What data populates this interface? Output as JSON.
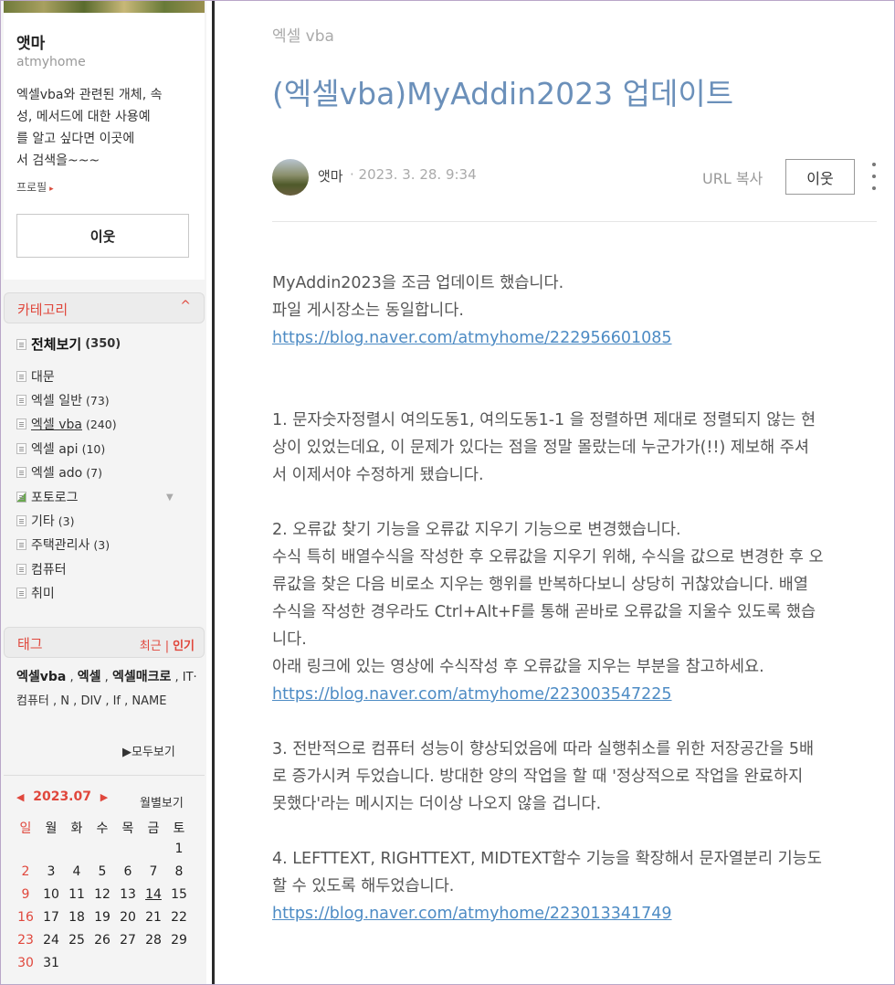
{
  "sidebar": {
    "profile": {
      "name": "앳마",
      "id": "atmyhome",
      "desc": "엑셀vba와 관련된 개체, 속\n성, 메서드에 대한 사용예\n를 알고 싶다면  이곳에\n서 검색을~~~",
      "profile_link": "프로필",
      "neighbor_button": "이웃"
    },
    "category": {
      "title": "카테고리",
      "collapse_glyph": "^",
      "all": {
        "label": "전체보기",
        "count": "(350)"
      },
      "items": [
        {
          "label": "대문",
          "count": ""
        },
        {
          "label": "엑셀 일반",
          "count": "(73)"
        },
        {
          "label": "엑셀 vba",
          "count": "(240)"
        },
        {
          "label": "엑셀 api",
          "count": "(10)"
        },
        {
          "label": "엑셀 ado",
          "count": "(7)"
        },
        {
          "label": "포토로그",
          "count": ""
        },
        {
          "label": "기타",
          "count": "(3)"
        },
        {
          "label": "주택관리사",
          "count": "(3)"
        },
        {
          "label": "컴퓨터",
          "count": ""
        },
        {
          "label": "취미",
          "count": ""
        }
      ]
    },
    "tags": {
      "title": "태그",
      "tab_recent": "최근",
      "tab_popular": "인기",
      "t1": "엑셀vba",
      "t2": "엑셀",
      "t3": "엑셀매크로",
      "t4": "IT·컴퓨터",
      "t5": "N",
      "t6": "DIV",
      "t7": "If",
      "t8": "NAME",
      "view_all": "▶모두보기"
    },
    "calendar": {
      "month": "2023.07",
      "prev": "◀",
      "next": "▶",
      "monthly_view": "월별보기",
      "weekdays": [
        "일",
        "월",
        "화",
        "수",
        "목",
        "금",
        "토"
      ],
      "weeks": [
        [
          "",
          "",
          "",
          "",
          "",
          "",
          "1"
        ],
        [
          "2",
          "3",
          "4",
          "5",
          "6",
          "7",
          "8"
        ],
        [
          "9",
          "10",
          "11",
          "12",
          "13",
          "14",
          "15"
        ],
        [
          "16",
          "17",
          "18",
          "19",
          "20",
          "21",
          "22"
        ],
        [
          "23",
          "24",
          "25",
          "26",
          "27",
          "28",
          "29"
        ],
        [
          "30",
          "31",
          "",
          "",
          "",
          "",
          ""
        ]
      ]
    }
  },
  "post": {
    "category": "엑셀 vba",
    "title": "(엑셀vba)MyAddin2023 업데이트",
    "author": "앳마",
    "date": "· 2023. 3. 28. 9:34",
    "url_copy": "URL 복사",
    "neighbor_button": "이웃",
    "body": {
      "intro1": "MyAddin2023을 조금 업데이트 했습니다.",
      "intro2": "파일 게시장소는 동일합니다.",
      "link1": "https://blog.naver.com/atmyhome/222956601085",
      "item1_l1": "1. 문자숫자정렬시 여의도동1, 여의도동1-1 을 정렬하면 제대로 정렬되지 않는 현",
      "item1_l2": "상이 있었는데요, 이 문제가 있다는 점을 정말 몰랐는데 누군가가(!!) 제보해 주셔",
      "item1_l3": "서 이제서야 수정하게 됐습니다.",
      "item2_l1": "2. 오류값 찾기 기능을 오류값 지우기 기능으로 변경했습니다.",
      "item2_l2": "수식 특히 배열수식을 작성한 후 오류값을 지우기 위해, 수식을 값으로 변경한 후 오",
      "item2_l3": "류값을 찾은 다음 비로소 지우는 행위를 반복하다보니 상당히 귀찮았습니다. 배열",
      "item2_l4": "수식을 작성한 경우라도 Ctrl+Alt+F를 통해 곧바로 오류값을 지울수 있도록 했습",
      "item2_l5": "니다.",
      "item2_l6": "아래 링크에 있는 영상에 수식작성 후 오류값을 지우는 부분을 참고하세요.",
      "link2": "https://blog.naver.com/atmyhome/223003547225",
      "item3_l1": "3. 전반적으로 컴퓨터 성능이 향상되었음에 따라 실행취소를 위한 저장공간을  5배",
      "item3_l2": "로 증가시켜 두었습니다. 방대한 양의 작업을 할 때 '정상적으로 작업을 완료하지",
      "item3_l3": "못했다'라는 메시지는 더이상 나오지 않을 겁니다.",
      "item4_l1": "4. LEFTTEXT, RIGHTTEXT, MIDTEXT함수 기능을 확장해서 문자열분리 기능도",
      "item4_l2": "할 수 있도록 해두었습니다.",
      "link3": "https://blog.naver.com/atmyhome/223013341749"
    }
  },
  "colors": {
    "accent_red": "#e0473c",
    "title_blue": "#6b90ba",
    "link_blue": "#4d8bc4"
  }
}
